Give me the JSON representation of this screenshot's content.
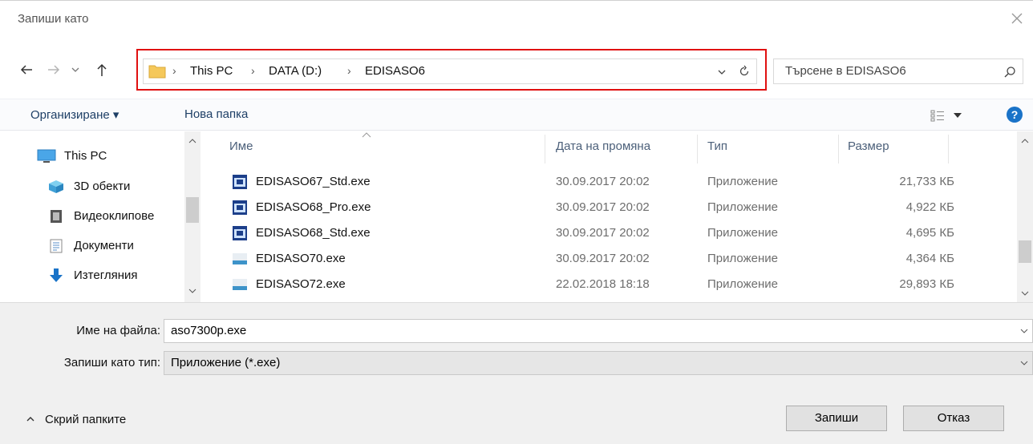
{
  "dialog": {
    "title": "Запиши като"
  },
  "address": {
    "crumbs": [
      "This PC",
      "DATA (D:)",
      "EDISASO6"
    ],
    "search_placeholder": "Търсене в EDISASO6"
  },
  "toolbar": {
    "organize_label": "Организиране ▾",
    "new_folder_label": "Нова папка"
  },
  "nav_pane": {
    "items": [
      {
        "label": "This PC",
        "icon": "computer-icon"
      },
      {
        "label": "3D обекти",
        "icon": "3d-objects-icon"
      },
      {
        "label": "Видеоклипове",
        "icon": "video-icon"
      },
      {
        "label": "Документи",
        "icon": "document-icon"
      },
      {
        "label": "Изтегляния",
        "icon": "download-icon"
      }
    ]
  },
  "file_list": {
    "columns": [
      "Име",
      "Дата на промяна",
      "Тип",
      "Размер"
    ],
    "rows": [
      {
        "name": "EDISASO67_Std.exe",
        "date": "30.09.2017 20:02",
        "type": "Приложение",
        "size": "21,733 КБ",
        "icon": "app-window-icon"
      },
      {
        "name": "EDISASO68_Pro.exe",
        "date": "30.09.2017 20:02",
        "type": "Приложение",
        "size": "4,922 КБ",
        "icon": "app-window-icon"
      },
      {
        "name": "EDISASO68_Std.exe",
        "date": "30.09.2017 20:02",
        "type": "Приложение",
        "size": "4,695 КБ",
        "icon": "app-window-icon"
      },
      {
        "name": "EDISASO70.exe",
        "date": "30.09.2017 20:02",
        "type": "Приложение",
        "size": "4,364 КБ",
        "icon": "aso-app-icon"
      },
      {
        "name": "EDISASO72.exe",
        "date": "22.02.2018 18:18",
        "type": "Приложение",
        "size": "29,893 КБ",
        "icon": "aso-app-icon"
      }
    ]
  },
  "form": {
    "filename_label": "Име на файла:",
    "filename_value": "aso7300p.exe",
    "filetype_label": "Запиши като тип:",
    "filetype_value": "Приложение (*.exe)"
  },
  "footer": {
    "hide_folders_label": "Скрий папките",
    "save_label": "Запиши",
    "cancel_label": "Отказ"
  },
  "colors": {
    "highlight_border": "#e01010",
    "link_blue": "#1e3f66",
    "help_blue": "#1a73c8"
  }
}
